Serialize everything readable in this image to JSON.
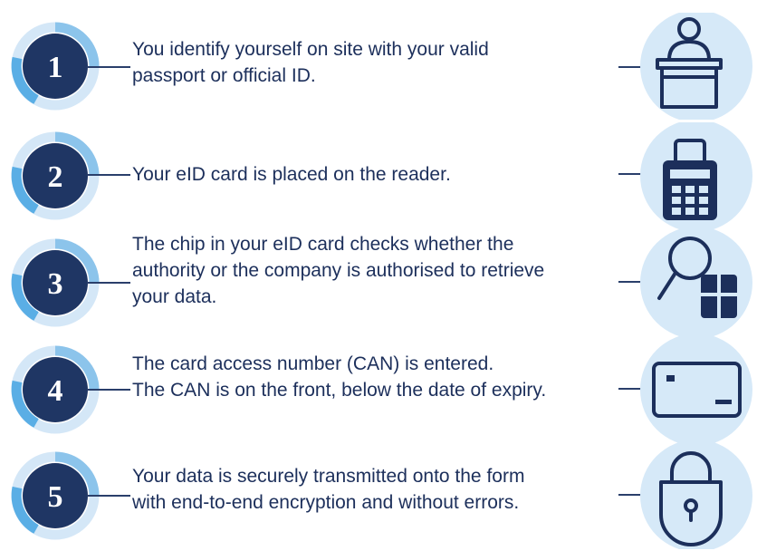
{
  "steps": [
    {
      "number": "1",
      "text": "You identify yourself on site with your valid\npassport or official ID.",
      "icon": "reception-desk-icon"
    },
    {
      "number": "2",
      "text": "Your eID card is placed on the reader.",
      "icon": "card-reader-icon"
    },
    {
      "number": "3",
      "text": "The chip in your eID card checks whether the\nauthority or the company is authorised to retrieve\nyour data.",
      "icon": "magnifier-chip-icon"
    },
    {
      "number": "4",
      "text": "The card access number (CAN) is entered.\nThe CAN is on the front, below the date of expiry.",
      "icon": "id-card-icon"
    },
    {
      "number": "5",
      "text": "Your data is securely transmitted onto the form\nwith end-to-end encryption and without errors.",
      "icon": "padlock-icon"
    }
  ],
  "colors": {
    "badge_dark": "#1f3664",
    "ring_light": "#d4e7f7",
    "ring_mid": "#8cc4eb",
    "ring_bright": "#5aaee5",
    "icon_bg": "#d6e9f8",
    "icon_stroke": "#1c2f5b",
    "text": "#1c2f5b"
  }
}
